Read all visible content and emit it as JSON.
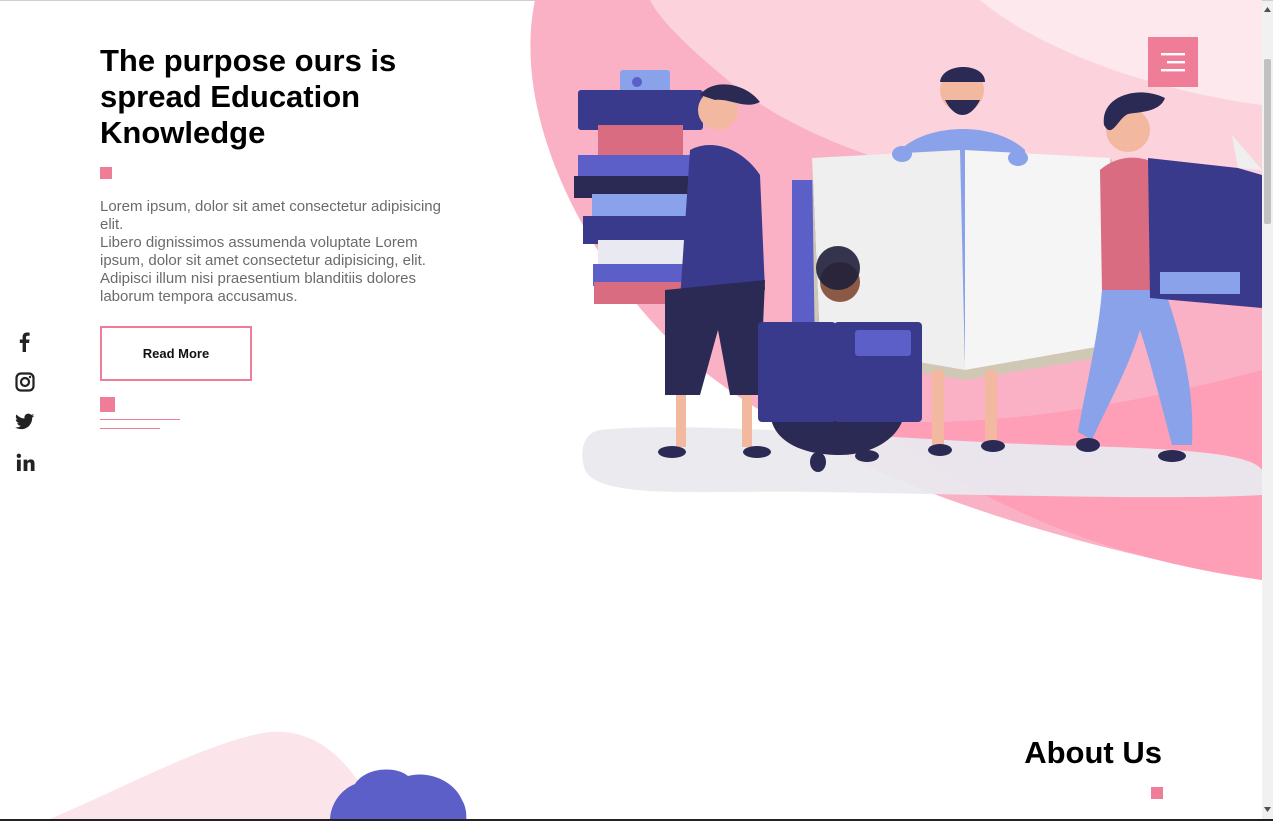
{
  "hero": {
    "title": "The purpose ours is spread Education Knowledge",
    "description_lines": [
      "Lorem ipsum, dolor sit amet consectetur adipisicing elit.",
      "Libero dignissimos assumenda voluptate Lorem ipsum, dolor sit amet consectetur adipisicing, elit. Adipisci illum nisi praesentium blanditiis dolores laborum tempora accusamus."
    ],
    "read_more_label": "Read More"
  },
  "social_icons": [
    "facebook-icon",
    "instagram-icon",
    "twitter-icon",
    "linkedin-icon"
  ],
  "menu": {
    "icon": "hamburger-icon"
  },
  "about": {
    "title": "About Us"
  },
  "colors": {
    "accent": "#f07d97",
    "blob_pink": "#fbb1c5",
    "blob_light": "#fde4ea",
    "illustration_navy": "#3a3a8c",
    "illustration_purple": "#5b5fc7",
    "text_gray": "#6b6b6b"
  }
}
